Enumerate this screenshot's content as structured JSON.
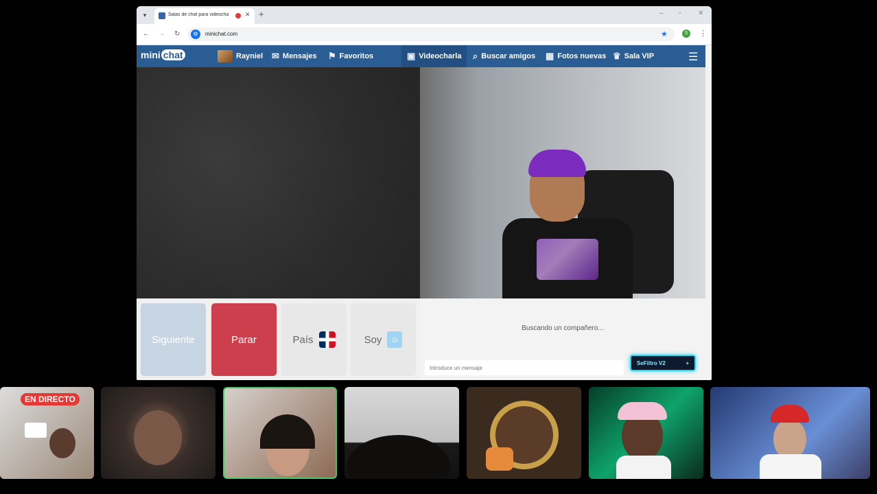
{
  "browser": {
    "tab_title": "Salas de chat para videocha",
    "tab_close": "✕",
    "new_tab": "+",
    "url": "minichat.com",
    "profile_initial": "S"
  },
  "site": {
    "logo_mini": "mini",
    "logo_chat": "chat",
    "nav": [
      {
        "label": "Rayniel",
        "icon": "avatar"
      },
      {
        "label": "Mensajes",
        "icon": "envelope-icon"
      },
      {
        "label": "Favoritos",
        "icon": "bookmark-icon"
      },
      {
        "label": "Videocharla",
        "icon": "video-chat-icon"
      },
      {
        "label": "Buscar amigos",
        "icon": "search-icon"
      },
      {
        "label": "Fotos nuevas",
        "icon": "grid-icon"
      },
      {
        "label": "Sala VIP",
        "icon": "crown-icon"
      }
    ]
  },
  "controls": {
    "next": "Siguiente",
    "stop": "Parar",
    "country": "País",
    "soy": "Soy"
  },
  "chat": {
    "status": "Buscando un compañero...",
    "input_placeholder": "Introduce un mensaje",
    "filter_button": "SeFiltro V2",
    "filter_plus": "+"
  },
  "stream_strip": {
    "live_badge": "EN DIRECTO"
  },
  "colors": {
    "nav_bg": "#2b5d95",
    "stop_red": "#cd3f4c",
    "next_blue": "#c7d5e3",
    "filter_glow": "#2fd4f0"
  }
}
